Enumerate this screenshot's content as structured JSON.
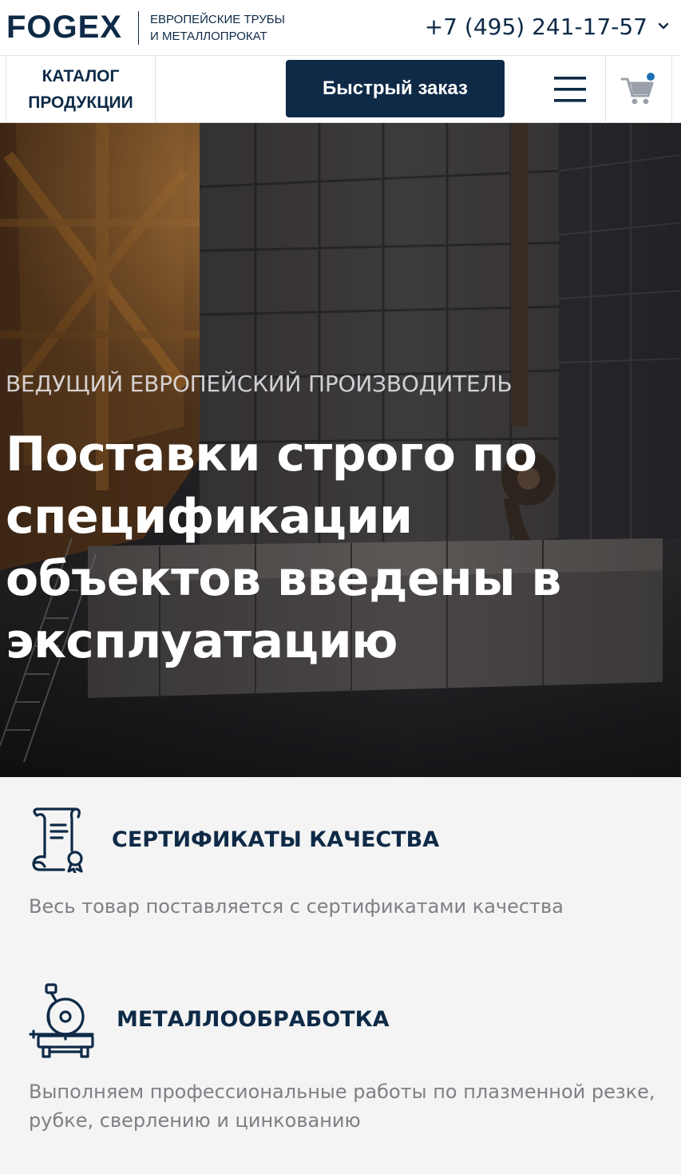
{
  "header": {
    "logo": "FOGEX",
    "tagline_line1": "ЕВРОПЕЙСКИЕ ТРУБЫ",
    "tagline_line2": "И МЕТАЛЛОПРОКАТ",
    "phone": "+7 (495) 241-17-57"
  },
  "nav": {
    "catalog_line1": "КАТАЛОГ",
    "catalog_line2": "ПРОДУКЦИИ",
    "quick_order": "Быстрый заказ",
    "icons": [
      "menu-icon",
      "cart-icon"
    ]
  },
  "hero": {
    "subtitle": "ВЕДУЩИЙ ЕВРОПЕЙСКИЙ ПРОИЗВОДИТЕЛЬ",
    "title": "Поставки строго по спецификации объектов введены в эксплуатацию"
  },
  "features": [
    {
      "icon": "certificate-scroll-icon",
      "title": "СЕРТИФИКАТЫ КАЧЕСТВА",
      "text": "Весь товар поставляется с сертификатами качества"
    },
    {
      "icon": "saw-machine-icon",
      "title": "МЕТАЛЛООБРАБОТКА",
      "text": "Выполняем профессиональные работы по плазменной резке, рубке, сверлению и цинкованию"
    }
  ],
  "colors": {
    "brand": "#0e2a47",
    "accent_dot": "#1a6fb5",
    "muted_text": "#7f7f86",
    "background": "#f4f4f4"
  }
}
